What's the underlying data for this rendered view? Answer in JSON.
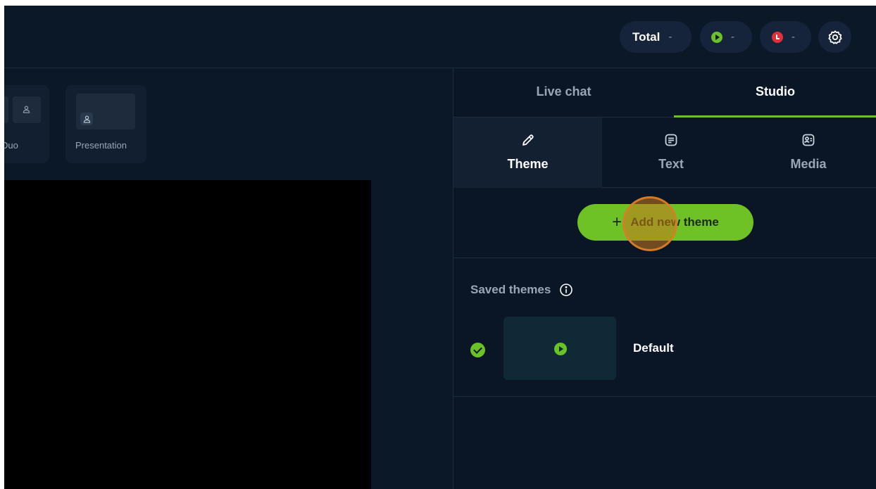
{
  "topbar": {
    "total_label": "Total",
    "total_value": "-",
    "live_value": "-",
    "rec_value": "-",
    "settings_icon": "gear-icon"
  },
  "layouts": [
    {
      "label": "Duo",
      "visible_label": "Duo",
      "icon": "person-icon"
    },
    {
      "label": "Presentation",
      "icon": "person-icon"
    }
  ],
  "panel": {
    "tabs": [
      {
        "label": "Live chat"
      },
      {
        "label": "Studio"
      }
    ],
    "subtabs": [
      {
        "label": "Theme",
        "icon": "pencil-icon"
      },
      {
        "label": "Text",
        "icon": "text-icon"
      },
      {
        "label": "Media",
        "icon": "media-icon"
      }
    ],
    "add_button_label": "Add new theme",
    "saved_title": "Saved themes",
    "themes": [
      {
        "name": "Default",
        "selected": true
      }
    ]
  },
  "colors": {
    "background": "#0b1828",
    "accent": "#6ac227",
    "record": "#e0303a"
  }
}
